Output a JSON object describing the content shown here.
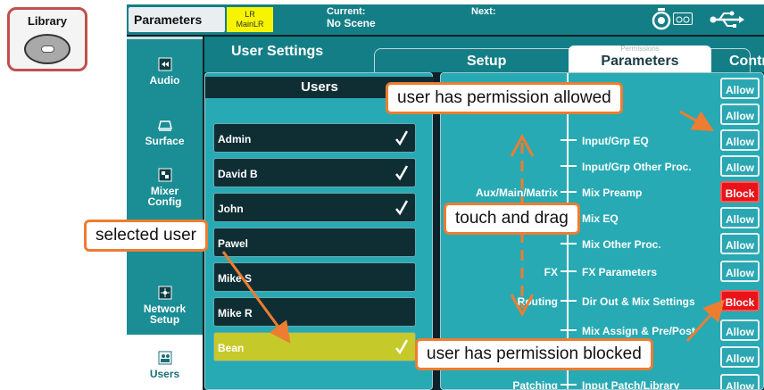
{
  "library": {
    "label": "Library"
  },
  "topbar": {
    "title": "Parameters",
    "lr_line1": "LR",
    "lr_line2": "MainLR",
    "current_label": "Current:",
    "current_value": "No Scene",
    "next_label": "Next:"
  },
  "nav": {
    "items": [
      {
        "label": "Audio",
        "icon": "audio-icon"
      },
      {
        "label": "Surface",
        "icon": "surface-icon"
      },
      {
        "label_1": "Mixer",
        "label_2": "Config",
        "icon": "mixer-config-icon"
      },
      {
        "label_1": "Network",
        "label_2": "Setup",
        "icon": "network-icon"
      },
      {
        "label": "Users",
        "icon": "users-icon"
      }
    ]
  },
  "tabs": {
    "user_settings": "User Settings",
    "setup": "Setup",
    "permissions": "Permissions",
    "parameters": "Parameters",
    "control": "Control"
  },
  "users": {
    "header": "Users",
    "rows": [
      {
        "name": "Admin",
        "checked": true
      },
      {
        "name": "David B",
        "checked": true
      },
      {
        "name": "John",
        "checked": true
      },
      {
        "name": "Pawel",
        "checked": false
      },
      {
        "name": "Mike S",
        "checked": false
      },
      {
        "name": "Mike R",
        "checked": false
      },
      {
        "name": "Bean",
        "checked": true,
        "selected": true
      }
    ]
  },
  "permissions": {
    "rows": [
      {
        "category": "",
        "label": "",
        "state": "Allow"
      },
      {
        "category": "",
        "label": "",
        "state": "Allow"
      },
      {
        "category": "",
        "label": "Input/Grp EQ",
        "state": "Allow"
      },
      {
        "category": "",
        "label": "Input/Grp Other Proc.",
        "state": "Allow"
      },
      {
        "category": "Aux/Main/Matrix",
        "label": "Mix Preamp",
        "state": "Block"
      },
      {
        "category": "",
        "label": "Mix EQ",
        "state": "Allow"
      },
      {
        "category": "",
        "label": "Mix Other Proc.",
        "state": "Allow"
      },
      {
        "category": "FX",
        "label": "FX Parameters",
        "state": "Allow"
      },
      {
        "category": "Routing",
        "label": "Dir Out & Mix Settings",
        "state": "Block"
      },
      {
        "category": "",
        "label": "Mix Assign & Pre/Post",
        "state": "Allow"
      },
      {
        "category": "",
        "label": "",
        "state": "Allow"
      },
      {
        "category": "Patching",
        "label": "Input Patch/Library",
        "state": "Allow"
      }
    ]
  },
  "annotations": {
    "allowed": "user has permission allowed",
    "drag": "touch and drag",
    "selected": "selected user",
    "blocked": "user has permission blocked"
  },
  "colors": {
    "accent": "#ed7d31",
    "teal": "#147e86",
    "block": "#e8141a",
    "selected_user": "#c6c92a"
  }
}
